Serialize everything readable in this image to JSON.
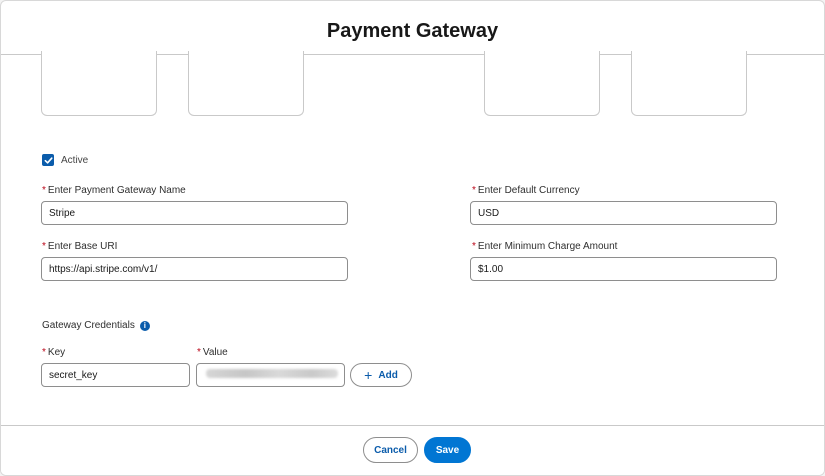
{
  "modal": {
    "title": "Payment Gateway"
  },
  "form": {
    "active": {
      "label": "Active",
      "checked": true
    },
    "gateway_name": {
      "label": "Enter Payment Gateway Name",
      "value": "Stripe"
    },
    "default_currency": {
      "label": "Enter Default Currency",
      "value": "USD"
    },
    "base_uri": {
      "label": "Enter Base URI",
      "value": "https://api.stripe.com/v1/"
    },
    "min_charge": {
      "label": "Enter Minimum Charge Amount",
      "value": "$1.00"
    },
    "required_marker": "*"
  },
  "credentials": {
    "section_label": "Gateway Credentials",
    "info_icon": "info-icon",
    "key_label": "Key",
    "value_label": "Value",
    "key_value": "secret_key",
    "add_label": "Add",
    "add_icon": "+"
  },
  "footer": {
    "cancel_label": "Cancel",
    "save_label": "Save"
  },
  "colors": {
    "brand": "#0176d3",
    "accent": "#0b5cab",
    "required": "#ba0517"
  }
}
